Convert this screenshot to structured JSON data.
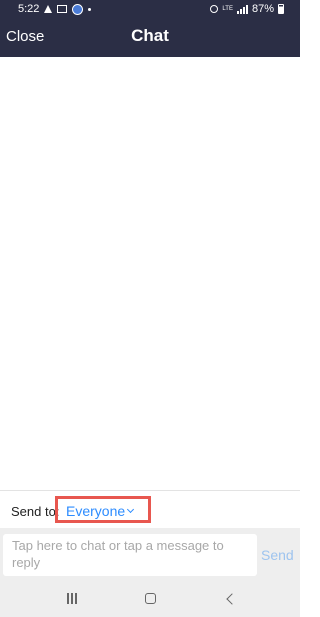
{
  "status_bar": {
    "time": "5:22",
    "network_label": "LTE",
    "battery": "87%",
    "left_icons": [
      "warning-icon",
      "image-notification-icon",
      "zoom-notification-icon",
      "dot-icon"
    ],
    "right_icons": [
      "alarm-icon",
      "lte-icon",
      "signal-icon",
      "battery-icon"
    ]
  },
  "header": {
    "close_label": "Close",
    "title": "Chat"
  },
  "send_to": {
    "label": "Send to:",
    "recipient": "Everyone"
  },
  "composer": {
    "placeholder": "Tap here to chat or tap a message to reply",
    "send_label": "Send"
  },
  "nav_bar": {
    "buttons": [
      "recents-icon",
      "home-icon",
      "back-icon"
    ]
  },
  "colors": {
    "header_bg": "#2b2e45",
    "accent": "#2d8cff",
    "send_disabled": "#9ec4ef",
    "highlight": "#e8574f"
  }
}
